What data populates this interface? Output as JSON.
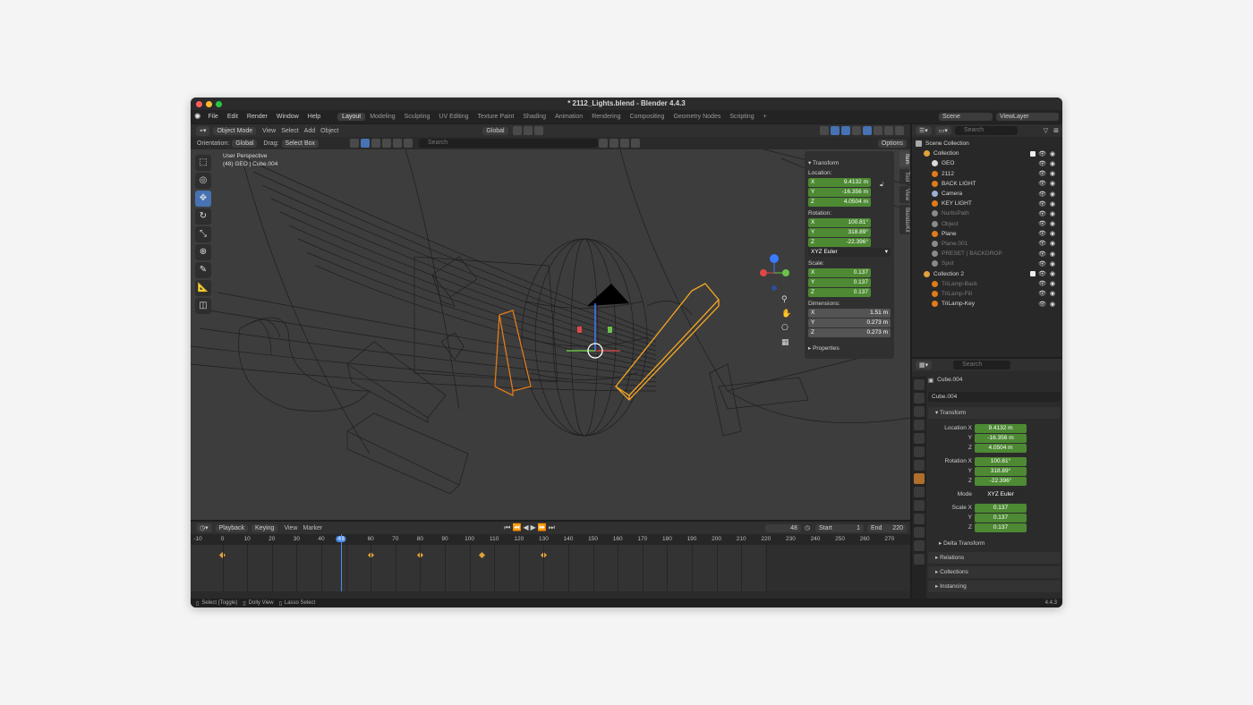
{
  "window": {
    "title": "* 2112_Lights.blend - Blender 4.4.3",
    "version": "4.4.3"
  },
  "menu": [
    "File",
    "Edit",
    "Render",
    "Window",
    "Help"
  ],
  "workspaces": [
    "Layout",
    "Modeling",
    "Sculpting",
    "UV Editing",
    "Texture Paint",
    "Shading",
    "Animation",
    "Rendering",
    "Compositing",
    "Geometry Nodes",
    "Scripting"
  ],
  "active_workspace": "Layout",
  "scene": {
    "scene_name": "Scene",
    "view_layer": "ViewLayer"
  },
  "viewport_header": {
    "mode": "Object Mode",
    "menus": [
      "View",
      "Select",
      "Add",
      "Object"
    ],
    "transform": "Global",
    "orientation_label": "Orientation:",
    "orientation": "Global",
    "drag_label": "Drag:",
    "drag": "Select Box",
    "search_placeholder": "Search",
    "options": "Options"
  },
  "viewport": {
    "perspective": "User Perspective",
    "context": "(48) GEO | Cube.004"
  },
  "npanel": {
    "transform": "Transform",
    "location_label": "Location:",
    "location": {
      "x": "9.4132 m",
      "y": "-16.356 m",
      "z": "4.0504 m"
    },
    "rotation_label": "Rotation:",
    "rotation": {
      "x": "100.81°",
      "y": "318.89°",
      "z": "-22.396°"
    },
    "rotation_mode": "XYZ Euler",
    "scale_label": "Scale:",
    "scale": {
      "x": "0.137",
      "y": "0.137",
      "z": "0.137"
    },
    "dimensions_label": "Dimensions:",
    "dimensions": {
      "x": "1.51 m",
      "y": "0.273 m",
      "z": "0.273 m"
    },
    "properties": "Properties",
    "tabs": [
      "Item",
      "Tool",
      "View",
      "BlenderKit"
    ]
  },
  "outliner": {
    "search_placeholder": "Search",
    "root": "Scene Collection",
    "rows": [
      {
        "name": "Collection",
        "indent": 1,
        "dim": false
      },
      {
        "name": "GEO",
        "indent": 2,
        "dim": false
      },
      {
        "name": "2112",
        "indent": 2,
        "dim": false
      },
      {
        "name": "BACK LIGHT",
        "indent": 2,
        "dim": false
      },
      {
        "name": "Camera",
        "indent": 2,
        "dim": false
      },
      {
        "name": "KEY LIGHT",
        "indent": 2,
        "dim": false
      },
      {
        "name": "NurbsPath",
        "indent": 2,
        "dim": true
      },
      {
        "name": "Object",
        "indent": 2,
        "dim": true
      },
      {
        "name": "Plane",
        "indent": 2,
        "dim": false
      },
      {
        "name": "Plane.001",
        "indent": 2,
        "dim": true
      },
      {
        "name": "PRESET | BACKDROP",
        "indent": 2,
        "dim": true
      },
      {
        "name": "Spot",
        "indent": 2,
        "dim": true
      },
      {
        "name": "Collection 2",
        "indent": 1,
        "dim": false
      },
      {
        "name": "TriLamp-Back",
        "indent": 2,
        "dim": true
      },
      {
        "name": "TriLamp-Fill",
        "indent": 2,
        "dim": true
      },
      {
        "name": "TriLamp-Key",
        "indent": 2,
        "dim": false
      }
    ]
  },
  "properties": {
    "search_placeholder": "Search",
    "object_name": "Cube.004",
    "data_name": "Cube.004",
    "transform": "Transform",
    "location_x_label": "Location X",
    "rotation_x_label": "Rotation X",
    "mode_label": "Mode",
    "scale_x_label": "Scale X",
    "y_label": "Y",
    "z_label": "Z",
    "location": [
      "9.4132 m",
      "-16.356 m",
      "4.0504 m"
    ],
    "rotation": [
      "100.81°",
      "318.89°",
      "-22.396°"
    ],
    "mode": "XYZ Euler",
    "scale": [
      "0.137",
      "0.137",
      "0.137"
    ],
    "sections": [
      "Delta Transform",
      "Relations",
      "Collections",
      "Instancing"
    ]
  },
  "timeline": {
    "menus": [
      "Playback",
      "Keying",
      "View",
      "Marker"
    ],
    "current_frame": "48",
    "start_label": "Start",
    "start": "1",
    "end_label": "End",
    "end": "220",
    "ticks": [
      "-10",
      "0",
      "10",
      "20",
      "30",
      "40",
      "48",
      "60",
      "70",
      "80",
      "90",
      "100",
      "110",
      "120",
      "130",
      "140",
      "150",
      "160",
      "170",
      "180",
      "190",
      "200",
      "210",
      "220",
      "230",
      "240",
      "250",
      "260",
      "270"
    ],
    "keyframes": [
      0,
      60,
      80,
      105,
      130
    ]
  },
  "statusbar": {
    "select": "Select (Toggle)",
    "dolly": "Dolly View",
    "lasso": "Lasso Select"
  },
  "colors": {
    "accent": "#4772b3",
    "field_green": "#4d8a33",
    "selection_orange": "#e07b1a",
    "active_orange": "#f5a623",
    "keyframe": "#e0a23a"
  }
}
